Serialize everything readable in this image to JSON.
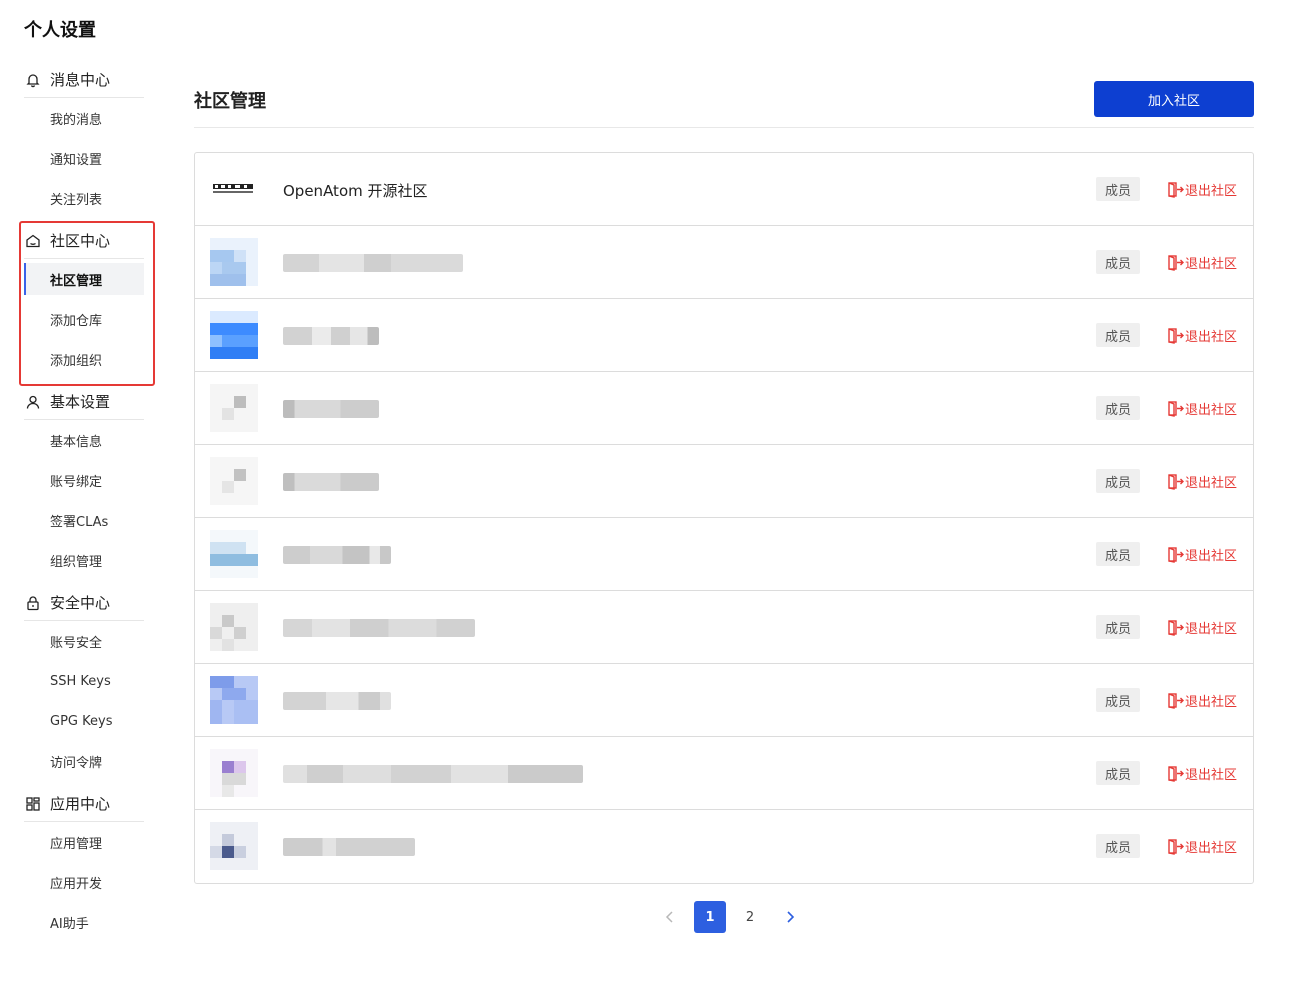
{
  "page": {
    "title": "个人设置"
  },
  "sidebar": {
    "groups": [
      {
        "label": "消息中心",
        "icon": "bell-icon",
        "items": [
          "我的消息",
          "通知设置",
          "关注列表"
        ]
      },
      {
        "label": "社区中心",
        "icon": "community-icon",
        "items": [
          "社区管理",
          "添加仓库",
          "添加组织"
        ],
        "active_item": "社区管理"
      },
      {
        "label": "基本设置",
        "icon": "user-icon",
        "items": [
          "基本信息",
          "账号绑定",
          "签署CLAs",
          "组织管理"
        ]
      },
      {
        "label": "安全中心",
        "icon": "lock-icon",
        "items": [
          "账号安全",
          "SSH Keys",
          "GPG Keys",
          "访问令牌"
        ]
      },
      {
        "label": "应用中心",
        "icon": "apps-grid-icon",
        "items": [
          "应用管理",
          "应用开发",
          "AI助手"
        ]
      }
    ]
  },
  "main": {
    "section_title": "社区管理",
    "join_button": "加入社区",
    "communities": [
      {
        "name": "OpenAtom 开源社区",
        "role": "成员",
        "action": "退出社区"
      },
      {
        "name": "",
        "role": "成员",
        "action": "退出社区"
      },
      {
        "name": "",
        "role": "成员",
        "action": "退出社区"
      },
      {
        "name": "",
        "role": "成员",
        "action": "退出社区"
      },
      {
        "name": "",
        "role": "成员",
        "action": "退出社区"
      },
      {
        "name": "",
        "role": "成员",
        "action": "退出社区"
      },
      {
        "name": "",
        "role": "成员",
        "action": "退出社区"
      },
      {
        "name": "",
        "role": "成员",
        "action": "退出社区"
      },
      {
        "name": "",
        "role": "成员",
        "action": "退出社区"
      },
      {
        "name": "",
        "role": "成员",
        "action": "退出社区"
      }
    ]
  },
  "pagination": {
    "pages": [
      "1",
      "2"
    ],
    "current": "1"
  },
  "colors": {
    "accent": "#0d3fd1",
    "danger": "#e53935",
    "highlight": "#e53935",
    "page_active": "#2d5fe0"
  }
}
